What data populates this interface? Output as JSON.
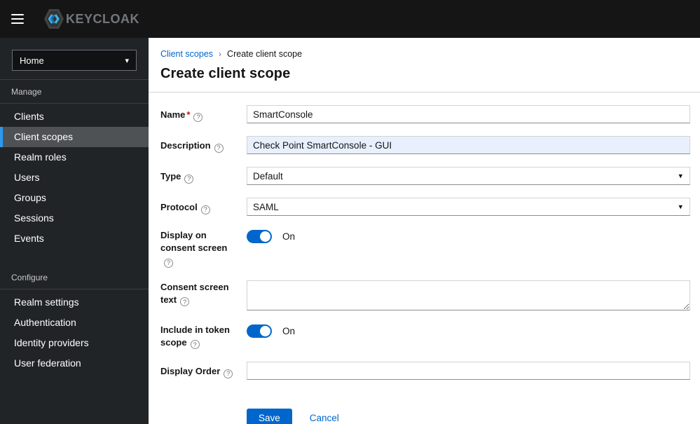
{
  "masthead": {
    "brand": "KEYCLOAK"
  },
  "sidebar": {
    "realm_selector": {
      "value": "Home"
    },
    "sections": [
      {
        "label": "Manage",
        "items": [
          {
            "label": "Clients"
          },
          {
            "label": "Client scopes",
            "selected": true
          },
          {
            "label": "Realm roles"
          },
          {
            "label": "Users"
          },
          {
            "label": "Groups"
          },
          {
            "label": "Sessions"
          },
          {
            "label": "Events"
          }
        ]
      },
      {
        "label": "Configure",
        "items": [
          {
            "label": "Realm settings"
          },
          {
            "label": "Authentication"
          },
          {
            "label": "Identity providers"
          },
          {
            "label": "User federation"
          }
        ]
      }
    ]
  },
  "breadcrumb": {
    "parent": "Client scopes",
    "current": "Create client scope"
  },
  "page": {
    "title": "Create client scope"
  },
  "form": {
    "required_mark": "*",
    "name": {
      "label": "Name",
      "value": "SmartConsole"
    },
    "description": {
      "label": "Description",
      "value": "Check Point SmartConsole - GUI"
    },
    "type": {
      "label": "Type",
      "value": "Default"
    },
    "protocol": {
      "label": "Protocol",
      "value": "SAML"
    },
    "display_on_consent": {
      "label": "Display on consent screen",
      "state": "On"
    },
    "consent_screen_text": {
      "label": "Consent screen text",
      "value": ""
    },
    "include_in_token_scope": {
      "label": "Include in token scope",
      "state": "On"
    },
    "display_order": {
      "label": "Display Order",
      "value": ""
    }
  },
  "actions": {
    "save": "Save",
    "cancel": "Cancel"
  },
  "icons": {
    "help": "?",
    "caret": "▾",
    "breadcrumb_separator": "›"
  },
  "colors": {
    "primary": "#0066cc",
    "masthead_bg": "#151515",
    "sidebar_bg": "#212427",
    "selected_nav_bg": "#4f5255",
    "selected_nav_border": "#2b9af3",
    "autofill_bg": "#e8f0fe"
  }
}
